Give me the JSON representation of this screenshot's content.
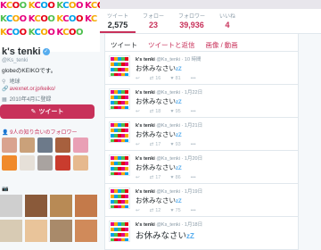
{
  "banner": {
    "wordmark": "KCO"
  },
  "stats": [
    {
      "label": "ツイート",
      "value": "2,575",
      "active": true
    },
    {
      "label": "フォロー",
      "value": "23"
    },
    {
      "label": "フォロワー",
      "value": "39,936"
    },
    {
      "label": "いいね",
      "value": "4"
    }
  ],
  "profile": {
    "name": "k's tenki",
    "handle": "@Ks_tenki",
    "bio": "globeのKEIKOです。",
    "location": "地球",
    "url": "avexnet.or.jp/keiko/",
    "joined": "2010年4月に登録"
  },
  "tweet_button": "ツイート",
  "followers_you_know": "9人の知り合いのフォロワー",
  "follower_colors": [
    "#d9a38f",
    "#caa17a",
    "#6d7a8a",
    "#a7603e",
    "#e9a0b5",
    "#f08a2c",
    "#e6e0d8",
    "#a9a3a0",
    "#c93c2e",
    "#e6b98e"
  ],
  "photo_colors": [
    "#cfcfcf",
    "#8a5a3a",
    "#b88a55",
    "#c47a4a",
    "#d8cbb4",
    "#e9c49a",
    "#a98a6a",
    "#d08a5a"
  ],
  "photos_label": "📷",
  "tabs": [
    {
      "label": "ツイート",
      "active": true
    },
    {
      "label": "ツイートと返信"
    },
    {
      "label": "画像 / 動画"
    }
  ],
  "tweets": [
    {
      "name": "k's tenki",
      "handle": "@Ks_tenki",
      "time": "10 時間",
      "text": "お休みなさい",
      "zz": "zZ",
      "retweets": "16",
      "likes": "81"
    },
    {
      "name": "k's tenki",
      "handle": "@Ks_tenki",
      "time": "1月22日",
      "text": "お休みなさい",
      "zz": "zZ",
      "retweets": "18",
      "likes": "95"
    },
    {
      "name": "k's tenki",
      "handle": "@Ks_tenki",
      "time": "1月21日",
      "text": "お休みなさい",
      "zz": "zZ",
      "retweets": "17",
      "likes": "93"
    },
    {
      "name": "k's tenki",
      "handle": "@Ks_tenki",
      "time": "1月20日",
      "text": "お休みなさい",
      "zz": "zZ",
      "retweets": "17",
      "likes": "86"
    },
    {
      "name": "k's tenki",
      "handle": "@Ks_tenki",
      "time": "1月19日",
      "text": "お休みなさい",
      "zz": "zZ",
      "retweets": "12",
      "likes": "75"
    },
    {
      "name": "k's tenki",
      "handle": "@Ks_tenki",
      "time": "1月18日",
      "text": "お休みなさい",
      "zz": "zZ",
      "retweets": "",
      "likes": ""
    }
  ]
}
